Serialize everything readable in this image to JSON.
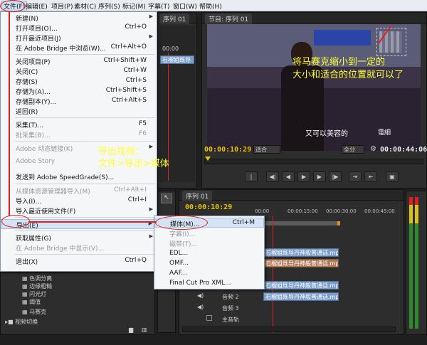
{
  "menubar": {
    "items": [
      "文件(F)",
      "编辑(E)",
      "项目(P)",
      "素材(C)",
      "序列(S)",
      "标记(M)",
      "字幕(T)",
      "窗口(W)",
      "帮助(H)"
    ]
  },
  "file_menu": {
    "items": [
      {
        "label": "新建(N)",
        "shortcut": ""
      },
      {
        "label": "打开项目(O)...",
        "shortcut": "Ctrl+O"
      },
      {
        "label": "打开最近项目(J)",
        "shortcut": ""
      },
      {
        "label": "在 Adobe Bridge 中浏览(W)...",
        "shortcut": "Ctrl+Alt+O"
      },
      {
        "label": "关闭项目(P)",
        "shortcut": "Ctrl+Shift+W"
      },
      {
        "label": "关闭(C)",
        "shortcut": "Ctrl+W"
      },
      {
        "label": "存储(S)",
        "shortcut": "Ctrl+S"
      },
      {
        "label": "存储为(A)...",
        "shortcut": "Ctrl+Shift+S"
      },
      {
        "label": "存储副本(Y)...",
        "shortcut": "Ctrl+Alt+S"
      },
      {
        "label": "返回(R)",
        "shortcut": ""
      },
      {
        "label": "采集(T)...",
        "shortcut": "F5"
      },
      {
        "label": "批采集(B)...",
        "shortcut": "F6"
      },
      {
        "label": "Adobe 动态链接(K)",
        "shortcut": ""
      },
      {
        "label": "Adobe Story",
        "shortcut": ""
      },
      {
        "label": "发送到 Adobe SpeedGrade(S)...",
        "shortcut": ""
      },
      {
        "label": "从媒体资源管理器导入(M)",
        "shortcut": "Ctrl+Alt+I"
      },
      {
        "label": "导入(I)...",
        "shortcut": "Ctrl+I"
      },
      {
        "label": "导入最近使用文件(F)",
        "shortcut": ""
      },
      {
        "label": "导出(E)",
        "shortcut": ""
      },
      {
        "label": "获取属性(G)",
        "shortcut": ""
      },
      {
        "label": "在 Adobe Bridge 中显示(V)...",
        "shortcut": ""
      },
      {
        "label": "退出(X)",
        "shortcut": "Ctrl+Q"
      }
    ]
  },
  "export_submenu": {
    "items": [
      {
        "label": "媒体(M)...",
        "shortcut": "Ctrl+M"
      },
      {
        "label": "字幕(I)...",
        "shortcut": ""
      },
      {
        "label": "磁带(T)...",
        "shortcut": ""
      },
      {
        "label": "EDL...",
        "shortcut": ""
      },
      {
        "label": "OMF...",
        "shortcut": ""
      },
      {
        "label": "AAF...",
        "shortcut": ""
      },
      {
        "label": "Final Cut Pro XML...",
        "shortcut": ""
      }
    ]
  },
  "source_panel": {
    "tab": "序列 01",
    "timecode": "00:00",
    "clip": "石榴姐既导"
  },
  "program_monitor": {
    "tab": "节目: 序列 01",
    "timecode_current": "00:00:10:29",
    "timecode_total": "00:00:44:06",
    "zoom": "适合",
    "quality": "全分",
    "caption": "又可以美容的",
    "label_text": "電細"
  },
  "timeline": {
    "tab": "序列 01",
    "timecode": "00:00:10:29",
    "ruler": [
      "00:00",
      "00:00:15:00",
      "00:00:30:00",
      "00:00:45:00"
    ],
    "clips": [
      "石榴姐既导丹神般普通话.mp4[V]",
      "石榴姐既导丹神般普通话.mp4[V]",
      "石榴姐既导丹神般普通话.mp4[A]",
      "石榴姐既导丹神般普通话.mp4[A]"
    ],
    "tracks": [
      "音频 2",
      "音频 3",
      "主音轨"
    ]
  },
  "effects_list": {
    "items": [
      "色调分离",
      "边缘粗糙",
      "闪光灯",
      "阈值",
      "马赛克"
    ],
    "folder": "视频切换"
  },
  "annotations": {
    "mosaic_note_line1": "将马赛克缩小到一定的",
    "mosaic_note_line2": "大小和适合的位置就可以了",
    "export_note_line1": "导出视频：",
    "export_note_line2": "文件>导出>媒体"
  },
  "colors": {
    "timecode": "#e6c200",
    "annotation": "#ffff33",
    "callout": "#e02020",
    "menu_highlight": "#d5e3f5"
  }
}
